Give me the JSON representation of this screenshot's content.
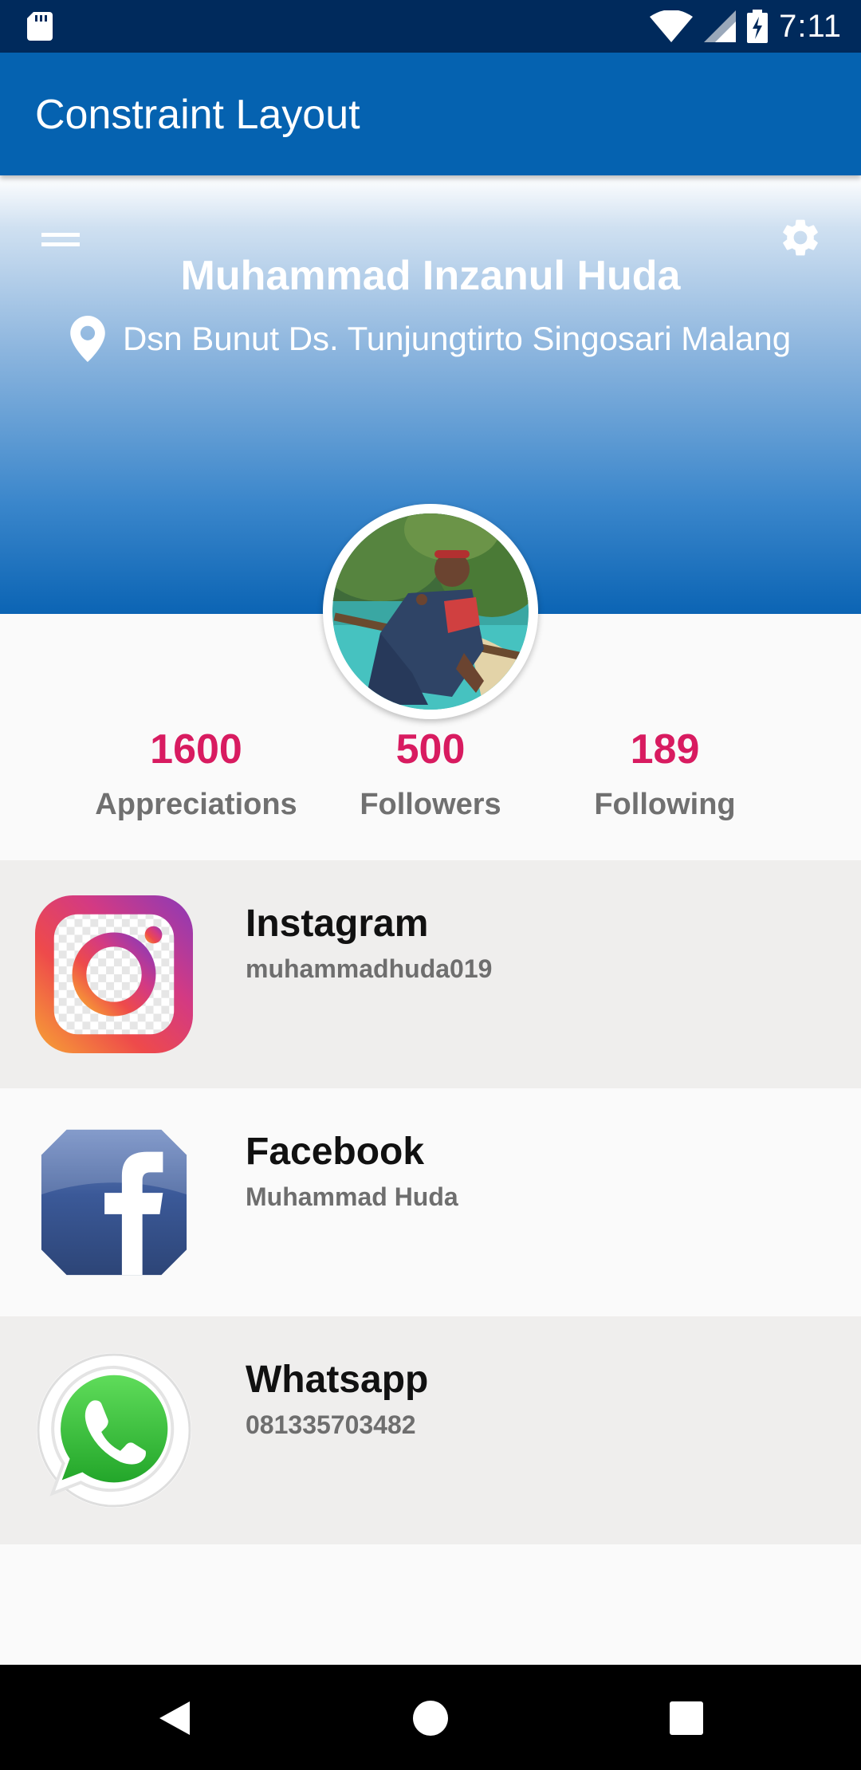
{
  "status_bar": {
    "time": "7:11",
    "icons": [
      "sd-card-icon",
      "wifi-icon",
      "cellular-signal-icon",
      "battery-charging-icon"
    ]
  },
  "app_bar": {
    "title": "Constraint Layout"
  },
  "profile": {
    "name": "Muhammad Inzanul Huda",
    "location": "Dsn Bunut Ds. Tunjungtirto Singosari Malang",
    "header_icons": [
      "menu-icon",
      "settings-icon",
      "location-pin-icon"
    ]
  },
  "stats": [
    {
      "value": "1600",
      "label": "Appreciations"
    },
    {
      "value": "500",
      "label": "Followers"
    },
    {
      "value": "189",
      "label": "Following"
    }
  ],
  "social": [
    {
      "title": "Instagram",
      "subtitle": "muhammadhuda019",
      "icon": "instagram-icon"
    },
    {
      "title": "Facebook",
      "subtitle": "Muhammad Huda",
      "icon": "facebook-icon"
    },
    {
      "title": "Whatsapp",
      "subtitle": "081335703482",
      "icon": "whatsapp-icon"
    }
  ],
  "nav_bar": {
    "buttons": [
      "back-icon",
      "home-icon",
      "recents-icon"
    ]
  },
  "colors": {
    "status_bar": "#002a5c",
    "app_bar": "#0562b0",
    "accent": "#d81b60",
    "stat_label": "#707070",
    "list_grey": "#efeeed"
  }
}
